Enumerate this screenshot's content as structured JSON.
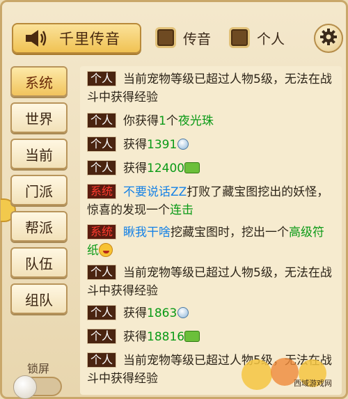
{
  "topbar": {
    "broadcast_label": "千里传音",
    "checkboxes": [
      {
        "label": "传音"
      },
      {
        "label": "个人"
      }
    ],
    "settings_icon": "gear-icon"
  },
  "sidebar": {
    "tabs": [
      {
        "label": "系统",
        "active": true
      },
      {
        "label": "世界",
        "active": false
      },
      {
        "label": "当前",
        "active": false
      },
      {
        "label": "门派",
        "active": false
      },
      {
        "label": "帮派",
        "active": false
      },
      {
        "label": "队伍",
        "active": false
      },
      {
        "label": "组队",
        "active": false
      }
    ],
    "lock_label": "锁屏"
  },
  "messages": [
    {
      "tag": "个人",
      "tag_type": "personal",
      "parts": [
        {
          "text": "当前宠物等级已超过人物5级，无法在战斗中获得经验",
          "color": "normal"
        }
      ]
    },
    {
      "tag": "个人",
      "tag_type": "personal",
      "parts": [
        {
          "text": "你获得",
          "color": "normal"
        },
        {
          "text": "1",
          "color": "green"
        },
        {
          "text": "个",
          "color": "normal"
        },
        {
          "text": "夜光珠",
          "color": "green"
        }
      ]
    },
    {
      "tag": "个人",
      "tag_type": "personal",
      "parts": [
        {
          "text": "获得",
          "color": "normal"
        },
        {
          "text": "1391",
          "color": "green"
        }
      ],
      "icon": "silver-coin-icon"
    },
    {
      "tag": "个人",
      "tag_type": "personal",
      "parts": [
        {
          "text": "获得",
          "color": "normal"
        },
        {
          "text": "12400",
          "color": "green"
        }
      ],
      "icon": "exp-icon"
    },
    {
      "tag": "系统",
      "tag_type": "system",
      "parts": [
        {
          "text": "不要说话ZZ",
          "color": "blue"
        },
        {
          "text": "打败了藏宝图挖出的妖怪，惊喜的发现一个",
          "color": "normal"
        },
        {
          "text": "连击",
          "color": "green"
        }
      ]
    },
    {
      "tag": "系统",
      "tag_type": "system",
      "parts": [
        {
          "text": "瞅我干啥",
          "color": "blue"
        },
        {
          "text": "挖藏宝图时，挖出一个",
          "color": "normal"
        },
        {
          "text": "高级符纸",
          "color": "green"
        }
      ],
      "icon": "smile-emoji-icon"
    },
    {
      "tag": "个人",
      "tag_type": "personal",
      "parts": [
        {
          "text": "当前宠物等级已超过人物5级，无法在战斗中获得经验",
          "color": "normal"
        }
      ]
    },
    {
      "tag": "个人",
      "tag_type": "personal",
      "parts": [
        {
          "text": "获得",
          "color": "normal"
        },
        {
          "text": "1863",
          "color": "green"
        }
      ],
      "icon": "silver-coin-icon"
    },
    {
      "tag": "个人",
      "tag_type": "personal",
      "parts": [
        {
          "text": "获得",
          "color": "normal"
        },
        {
          "text": "18816",
          "color": "green"
        }
      ],
      "icon": "exp-icon"
    },
    {
      "tag": "个人",
      "tag_type": "personal",
      "parts": [
        {
          "text": "当前宠物等级已超过人物5级，无法在战斗中获得经验",
          "color": "normal"
        }
      ]
    }
  ],
  "watermark": {
    "text": "西域游戏网"
  },
  "colors": {
    "system_tag_text": "#ff3b2f",
    "green_text": "#0a9a16",
    "blue_text": "#1682e6",
    "panel_bg": "#f6ebcf"
  }
}
